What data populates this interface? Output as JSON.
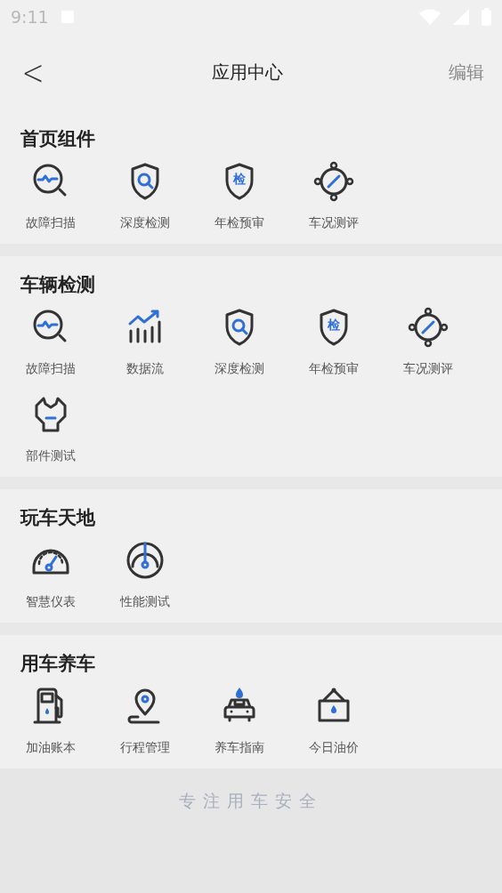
{
  "status_bar": {
    "time": "9:11"
  },
  "nav": {
    "back": "<",
    "title": "应用中心",
    "action": "编辑"
  },
  "sections": [
    {
      "title": "首页组件",
      "items": [
        {
          "label": "故障扫描",
          "kind": "scan"
        },
        {
          "label": "深度检测",
          "kind": "shield-search"
        },
        {
          "label": "年检预审",
          "kind": "shield-text",
          "glyph": "检"
        },
        {
          "label": "车况测评",
          "kind": "compass"
        }
      ]
    },
    {
      "title": "车辆检测",
      "items": [
        {
          "label": "故障扫描",
          "kind": "scan"
        },
        {
          "label": "数据流",
          "kind": "chart"
        },
        {
          "label": "深度检测",
          "kind": "shield-search"
        },
        {
          "label": "年检预审",
          "kind": "shield-text",
          "glyph": "检"
        },
        {
          "label": "车况测评",
          "kind": "compass"
        },
        {
          "label": "部件测试",
          "kind": "wrench"
        }
      ]
    },
    {
      "title": "玩车天地",
      "items": [
        {
          "label": "智慧仪表",
          "kind": "gauge"
        },
        {
          "label": "性能测试",
          "kind": "dial"
        }
      ]
    },
    {
      "title": "用车养车",
      "items": [
        {
          "label": "加油账本",
          "kind": "fuel"
        },
        {
          "label": "行程管理",
          "kind": "pin"
        },
        {
          "label": "养车指南",
          "kind": "car"
        },
        {
          "label": "今日油价",
          "kind": "sign"
        }
      ]
    }
  ],
  "footer": "专注用车安全"
}
